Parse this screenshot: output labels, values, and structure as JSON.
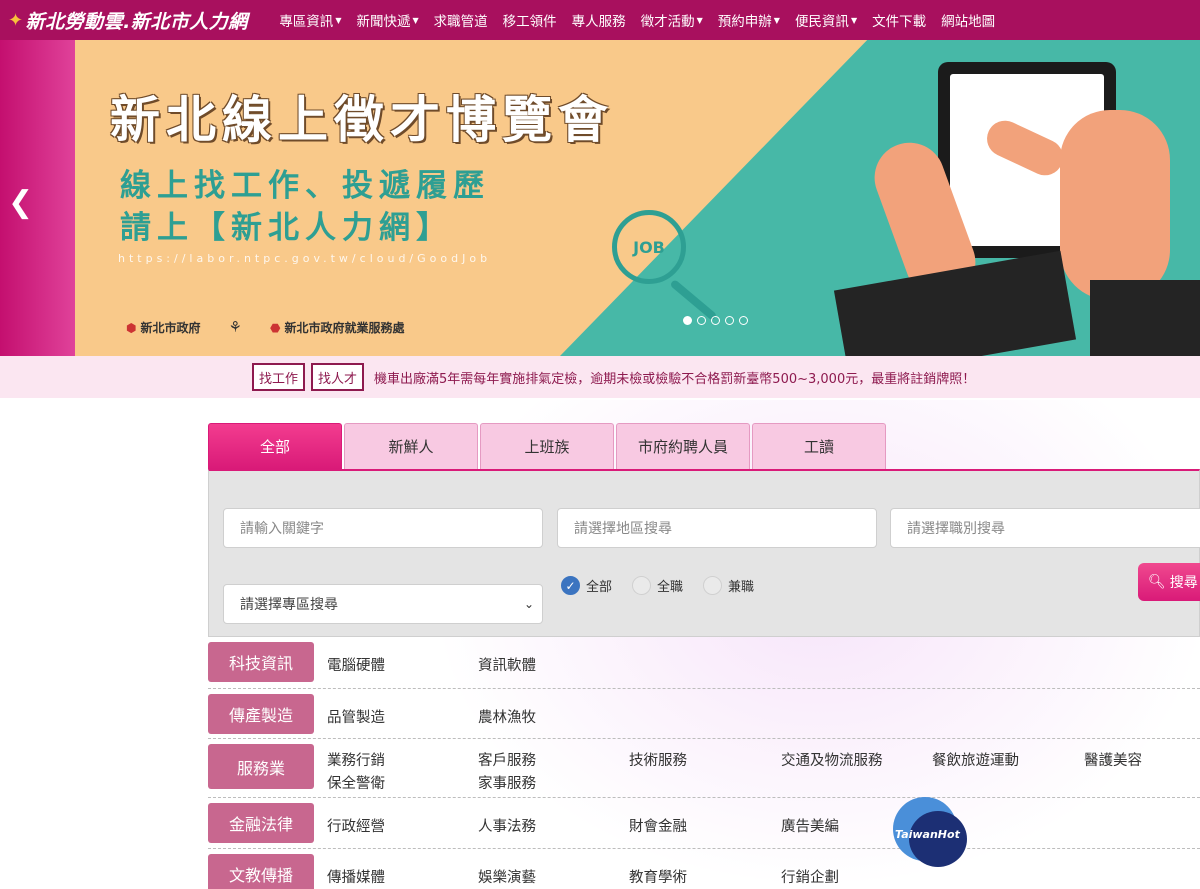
{
  "site": {
    "logo_text": "新北勞動雲.新北市人力網"
  },
  "nav": [
    {
      "label": "專區資訊",
      "dropdown": true
    },
    {
      "label": "新聞快遞",
      "dropdown": true
    },
    {
      "label": "求職管道",
      "dropdown": false
    },
    {
      "label": "移工領件",
      "dropdown": false
    },
    {
      "label": "專人服務",
      "dropdown": false
    },
    {
      "label": "徵才活動",
      "dropdown": true
    },
    {
      "label": "預約申辦",
      "dropdown": true
    },
    {
      "label": "便民資訊",
      "dropdown": true
    },
    {
      "label": "文件下載",
      "dropdown": false
    },
    {
      "label": "網站地圖",
      "dropdown": false
    }
  ],
  "banner": {
    "title": "新北線上徵才博覽會",
    "subtitle1": "線上找工作、投遞履歷",
    "subtitle2": "請上【新北人力網】",
    "url": "https://labor.ntpc.gov.tw/cloud/GoodJob",
    "lens_text": "JOB",
    "logo1": "新北市政府",
    "logo3": "新北市政府就業服務處",
    "slide_count": 5,
    "active_slide": 1
  },
  "notice": {
    "btn_find_job": "找工作",
    "btn_find_talent": "找人才",
    "text": "機車出廠滿5年需每年實施排氣定檢，逾期未檢或檢驗不合格罰新臺幣500~3,000元，最重將註銷牌照！"
  },
  "tabs": [
    "全部",
    "新鮮人",
    "上班族",
    "市府約聘人員",
    "工讀"
  ],
  "search": {
    "keyword_placeholder": "請輸入關鍵字",
    "area_placeholder": "請選擇地區搜尋",
    "job_placeholder": "請選擇職別搜尋",
    "zone_selected": "請選擇專區搜尋",
    "radio_all": "全部",
    "radio_fulltime": "全職",
    "radio_parttime": "兼職",
    "button_label": "搜尋"
  },
  "categories": [
    {
      "label": "科技資訊",
      "items": [
        "電腦硬體",
        "資訊軟體"
      ]
    },
    {
      "label": "傳產製造",
      "items": [
        "品管製造",
        "農林漁牧"
      ]
    },
    {
      "label": "服務業",
      "items": [
        "業務行銷",
        "客戶服務",
        "技術服務",
        "交通及物流服務",
        "餐飲旅遊運動",
        "醫護美容",
        "保全警衛",
        "家事服務"
      ]
    },
    {
      "label": "金融法律",
      "items": [
        "行政經營",
        "人事法務",
        "財會金融",
        "廣告美編"
      ]
    },
    {
      "label": "文教傳播",
      "items": [
        "傳播媒體",
        "娛樂演藝",
        "教育學術",
        "行銷企劃"
      ]
    }
  ],
  "watermark": "TaiwanHot",
  "colors": {
    "brand": "#a8105e",
    "tab_active": "#d91a78",
    "category_label": "#c8678f",
    "radio_checked": "#3b74c0"
  }
}
